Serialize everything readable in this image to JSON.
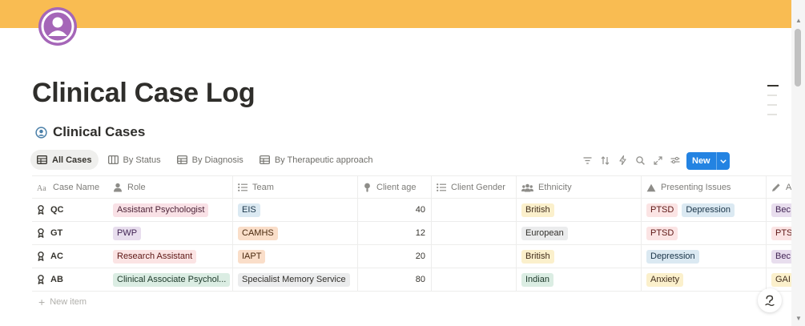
{
  "page": {
    "title": "Clinical Case Log",
    "cover_color": "#f9bc52",
    "avatar_color": "#a566b8"
  },
  "database": {
    "title": "Clinical Cases",
    "icon": "person-circle-icon",
    "views": [
      {
        "label": "All Cases",
        "icon": "table-icon",
        "active": true
      },
      {
        "label": "By Status",
        "icon": "board-icon",
        "active": false
      },
      {
        "label": "By Diagnosis",
        "icon": "table-icon",
        "active": false
      },
      {
        "label": "By Therapeutic approach",
        "icon": "table-icon",
        "active": false
      }
    ],
    "tools": [
      "filter-icon",
      "sort-icon",
      "automation-icon",
      "search-icon",
      "expand-icon",
      "settings-icon"
    ],
    "new_button": "New",
    "new_button_color": "#2383e2"
  },
  "table": {
    "columns": [
      {
        "label": "Case Name",
        "icon": "text-aa-icon"
      },
      {
        "label": "Role",
        "icon": "person-icon"
      },
      {
        "label": "Team",
        "icon": "list-icon"
      },
      {
        "label": "Client age",
        "icon": "person-pin-icon"
      },
      {
        "label": "Client Gender",
        "icon": "list-icon"
      },
      {
        "label": "Ethnicity",
        "icon": "people-icon"
      },
      {
        "label": "Presenting Issues",
        "icon": "triangle-icon"
      },
      {
        "label": "A",
        "icon": "pencil-icon"
      }
    ],
    "rows": [
      {
        "name": "QC",
        "role": "Assistant Psychologist",
        "team": "EIS",
        "age": "40",
        "gender": "",
        "ethnicity": "British",
        "issues": [
          "PTSD",
          "Depression"
        ],
        "last": "Bec"
      },
      {
        "name": "GT",
        "role": "PWP",
        "team": "CAMHS",
        "age": "12",
        "gender": "",
        "ethnicity": "European",
        "issues": [
          "PTSD"
        ],
        "last": "PTS"
      },
      {
        "name": "AC",
        "role": "Research Assistant",
        "team": "IAPT",
        "age": "20",
        "gender": "",
        "ethnicity": "British",
        "issues": [
          "Depression"
        ],
        "last": "Bec"
      },
      {
        "name": "AB",
        "role": "Clinical Associate Psychol...",
        "team": "Specialist Memory Service",
        "age": "80",
        "gender": "",
        "ethnicity": "Indian",
        "issues": [
          "Anxiety"
        ],
        "last": "GAI"
      }
    ],
    "new_item_label": "New item"
  },
  "help_icon": "question-mark-icon"
}
